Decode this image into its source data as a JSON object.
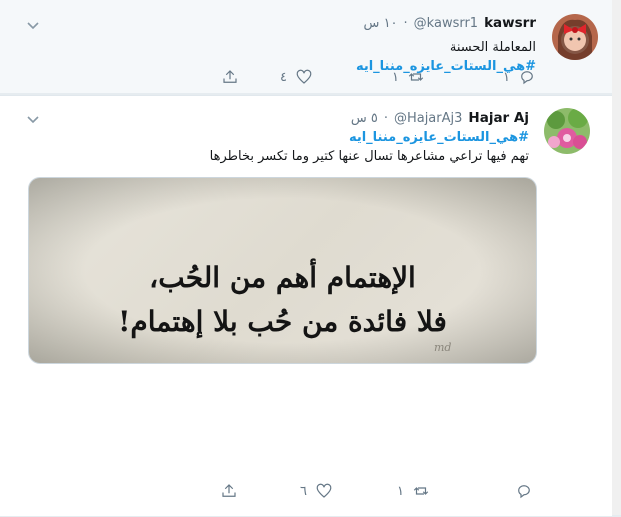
{
  "tweets": [
    {
      "name": "kawsrr",
      "handle": "@kawsrr1",
      "dot": "·",
      "time": "١٠ س",
      "text": "المعاملة الحسنة",
      "hashtag": "#هي_الستات_عايزه_مننا_ايه",
      "reply_count": "١",
      "retweet_count": "١",
      "like_count": "٤"
    },
    {
      "name": "Hajar Aj",
      "handle": "@HajarAj3",
      "dot": "·",
      "time": "٥ س",
      "hashtag": "#هي_الستات_عايزه_مننا_ايه",
      "text": "تهم فيها تراعي مشاعرها تسال عنها كتير وما تكسر بخاطرها",
      "image_line1": "الإهتمام أهم من الحُب،",
      "image_line2": "فلا فائدة من حُب بلا إهتمام!",
      "image_signature": "md",
      "reply_count": "",
      "retweet_count": "١",
      "like_count": "٦"
    }
  ],
  "colors": {
    "link": "#1b95e0",
    "muted": "#657786",
    "text": "#14171a",
    "background": "#e6ecf0"
  },
  "icons": [
    "chevron-down-icon",
    "reply-icon",
    "retweet-icon",
    "like-icon",
    "share-icon"
  ]
}
